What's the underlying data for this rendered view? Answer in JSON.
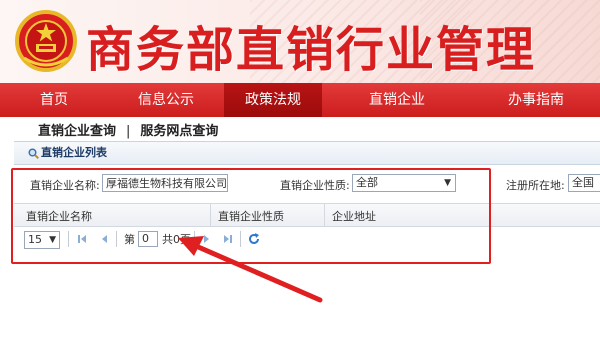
{
  "header": {
    "title": "商务部直销行业管理"
  },
  "nav": {
    "items": [
      {
        "label": "首页"
      },
      {
        "label": "信息公示"
      },
      {
        "label": "政策法规"
      },
      {
        "label": "直销企业"
      },
      {
        "label": "办事指南"
      }
    ],
    "active_index": 2
  },
  "subnav": {
    "links": [
      {
        "label": "直销企业查询"
      },
      {
        "label": "服务网点查询"
      }
    ],
    "separator": "|"
  },
  "panel": {
    "title": "直销企业列表"
  },
  "search_form": {
    "company_name_label": "直销企业名称:",
    "company_name_value": "厚福德生物科技有限公司",
    "nature_label": "直销企业性质:",
    "nature_value": "全部",
    "location_label": "注册所在地:",
    "location_value": "全国"
  },
  "table": {
    "columns": [
      "直销企业名称",
      "直销企业性质",
      "企业地址"
    ],
    "rows": []
  },
  "pager": {
    "page_size": "15",
    "page_prefix": "第",
    "current_page": "0",
    "total_text": "共0页"
  },
  "colors": {
    "brand_red": "#d81e1e",
    "nav_red": "#e33a3a",
    "nav_active": "#a30f0f",
    "annotation_red": "#e02020",
    "panel_text": "#1d3b66"
  }
}
